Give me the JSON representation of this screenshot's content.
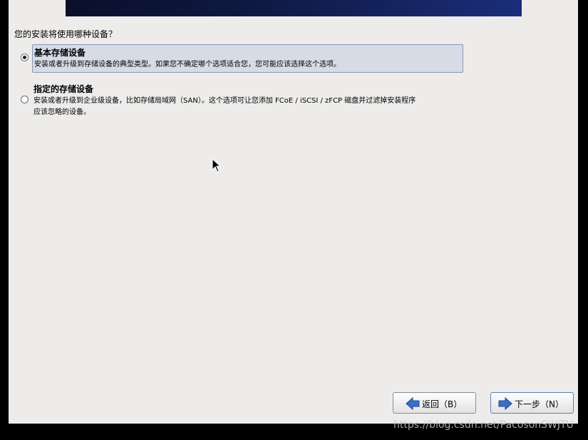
{
  "question": "您的安装将使用哪种设备？",
  "options": [
    {
      "title": "基本存储设备",
      "description": "安装或者升级到存储设备的典型类型。如果您不确定哪个选项适合您，您可能应该选择这个选项。",
      "selected": true
    },
    {
      "title": "指定的存储设备",
      "description_line1": "安装或者升级到企业级设备，比如存储局域网（SAN）。这个选项可让您添加 FCoE / iSCSI / zFCP 磁盘并过滤掉安装程序",
      "description_line2": "应该忽略的设备。",
      "selected": false
    }
  ],
  "buttons": {
    "back": "返回（B）",
    "next": "下一步（N）"
  },
  "icons": {
    "back": "arrow-left-icon",
    "next": "arrow-right-icon"
  },
  "colors": {
    "arrow": "#3a6fc4",
    "selection": "#d6dbe6"
  },
  "watermark": "https://blog.csdn.net/PacosonSWJTU"
}
